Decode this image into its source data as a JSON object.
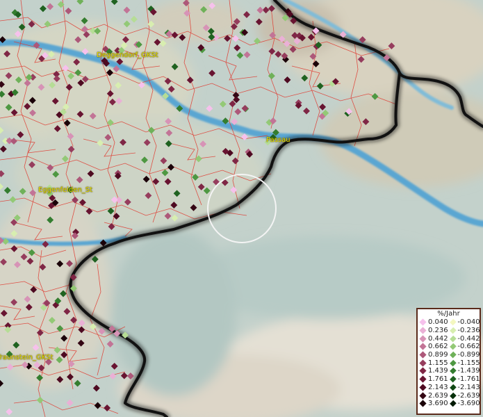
{
  "map": {
    "colors": {
      "plain": "#c9d6cf",
      "lowland": "#b4c6c2",
      "river": "#4b9ccd",
      "border": "#111111",
      "districts": "#e0382e"
    }
  },
  "cities": [
    {
      "name": "Deggendorf_GKSt"
    },
    {
      "name": "Passau"
    },
    {
      "name": "Eggenfelden_St"
    },
    {
      "name": "Traunstein_GKSt"
    }
  ],
  "legend": {
    "title": "%/Jahr",
    "positive": [
      {
        "label": "0.040",
        "color": "#f6c1ec"
      },
      {
        "label": "0.236",
        "color": "#eab0d6"
      },
      {
        "label": "0.442",
        "color": "#d793b6"
      },
      {
        "label": "0.662",
        "color": "#c27496"
      },
      {
        "label": "0.899",
        "color": "#ad5879"
      },
      {
        "label": "1.155",
        "color": "#963d5d"
      },
      {
        "label": "1.439",
        "color": "#7f2645"
      },
      {
        "label": "1.761",
        "color": "#681431"
      },
      {
        "label": "2.143",
        "color": "#4e0a21"
      },
      {
        "label": "2.639",
        "color": "#330513"
      },
      {
        "label": "3.690",
        "color": "#1a0008"
      }
    ],
    "negative": [
      {
        "label": "-0.040",
        "color": "#f4f7c0"
      },
      {
        "label": "-0.236",
        "color": "#d8eeb0"
      },
      {
        "label": "-0.442",
        "color": "#b6dd96"
      },
      {
        "label": "-0.662",
        "color": "#93c976"
      },
      {
        "label": "-0.899",
        "color": "#6fb159"
      },
      {
        "label": "-1.155",
        "color": "#4e9842"
      },
      {
        "label": "-1.439",
        "color": "#347d2f"
      },
      {
        "label": "-1.761",
        "color": "#1f6220"
      },
      {
        "label": "-2.143",
        "color": "#104814"
      },
      {
        "label": "-2.639",
        "color": "#06300a"
      },
      {
        "label": "-3.690",
        "color": "#011a04"
      }
    ]
  }
}
